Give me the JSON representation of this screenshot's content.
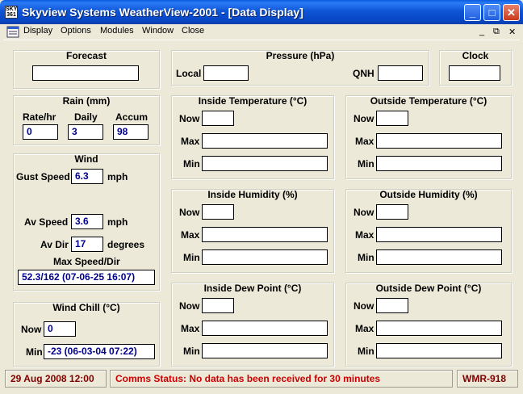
{
  "window": {
    "title": "Skyview Systems WeatherView-2001 - [Data Display]",
    "icon_text": "SKY 361"
  },
  "menu": {
    "items": [
      "Display",
      "Options",
      "Modules",
      "Window",
      "Close"
    ]
  },
  "forecast": {
    "title": "Forecast",
    "value": ""
  },
  "pressure": {
    "title": "Pressure (hPa)",
    "local_label": "Local",
    "local_value": "",
    "qnh_label": "QNH",
    "qnh_value": ""
  },
  "clock": {
    "title": "Clock",
    "value": ""
  },
  "rain": {
    "title": "Rain (mm)",
    "rate_label": "Rate/hr",
    "daily_label": "Daily",
    "accum_label": "Accum",
    "rate_value": "0",
    "daily_value": "3",
    "accum_value": "98"
  },
  "wind": {
    "title": "Wind",
    "gust_label": "Gust Speed",
    "gust_value": "6.3",
    "gust_unit": "mph",
    "av_speed_label": "Av Speed",
    "av_speed_value": "3.6",
    "av_speed_unit": "mph",
    "av_dir_label": "Av Dir",
    "av_dir_value": "17",
    "av_dir_unit": "degrees",
    "max_label": "Max Speed/Dir",
    "max_value": "52.3/162 (07-06-25 16:07)"
  },
  "wind_chill": {
    "title": "Wind Chill (°C)",
    "now_label": "Now",
    "now_value": "0",
    "min_label": "Min",
    "min_value": "-23 (06-03-04 07:22)"
  },
  "panels": {
    "inside_temp": {
      "title": "Inside Temperature (°C)",
      "now": "Now",
      "max": "Max",
      "min": "Min"
    },
    "outside_temp": {
      "title": "Outside Temperature (°C)",
      "now": "Now",
      "max": "Max",
      "min": "Min"
    },
    "inside_hum": {
      "title": "Inside Humidity (%)",
      "now": "Now",
      "max": "Max",
      "min": "Min"
    },
    "outside_hum": {
      "title": "Outside Humidity (%)",
      "now": "Now",
      "max": "Max",
      "min": "Min"
    },
    "inside_dew": {
      "title": "Inside Dew Point (°C)",
      "now": "Now",
      "max": "Max",
      "min": "Min"
    },
    "outside_dew": {
      "title": "Outside Dew Point (°C)",
      "now": "Now",
      "max": "Max",
      "min": "Min"
    }
  },
  "status": {
    "datetime": "29 Aug 2008 12:00",
    "comms": "Comms Status: No data has been received for 30 minutes",
    "device": "WMR-918",
    "comms_color": "#cc0000"
  }
}
